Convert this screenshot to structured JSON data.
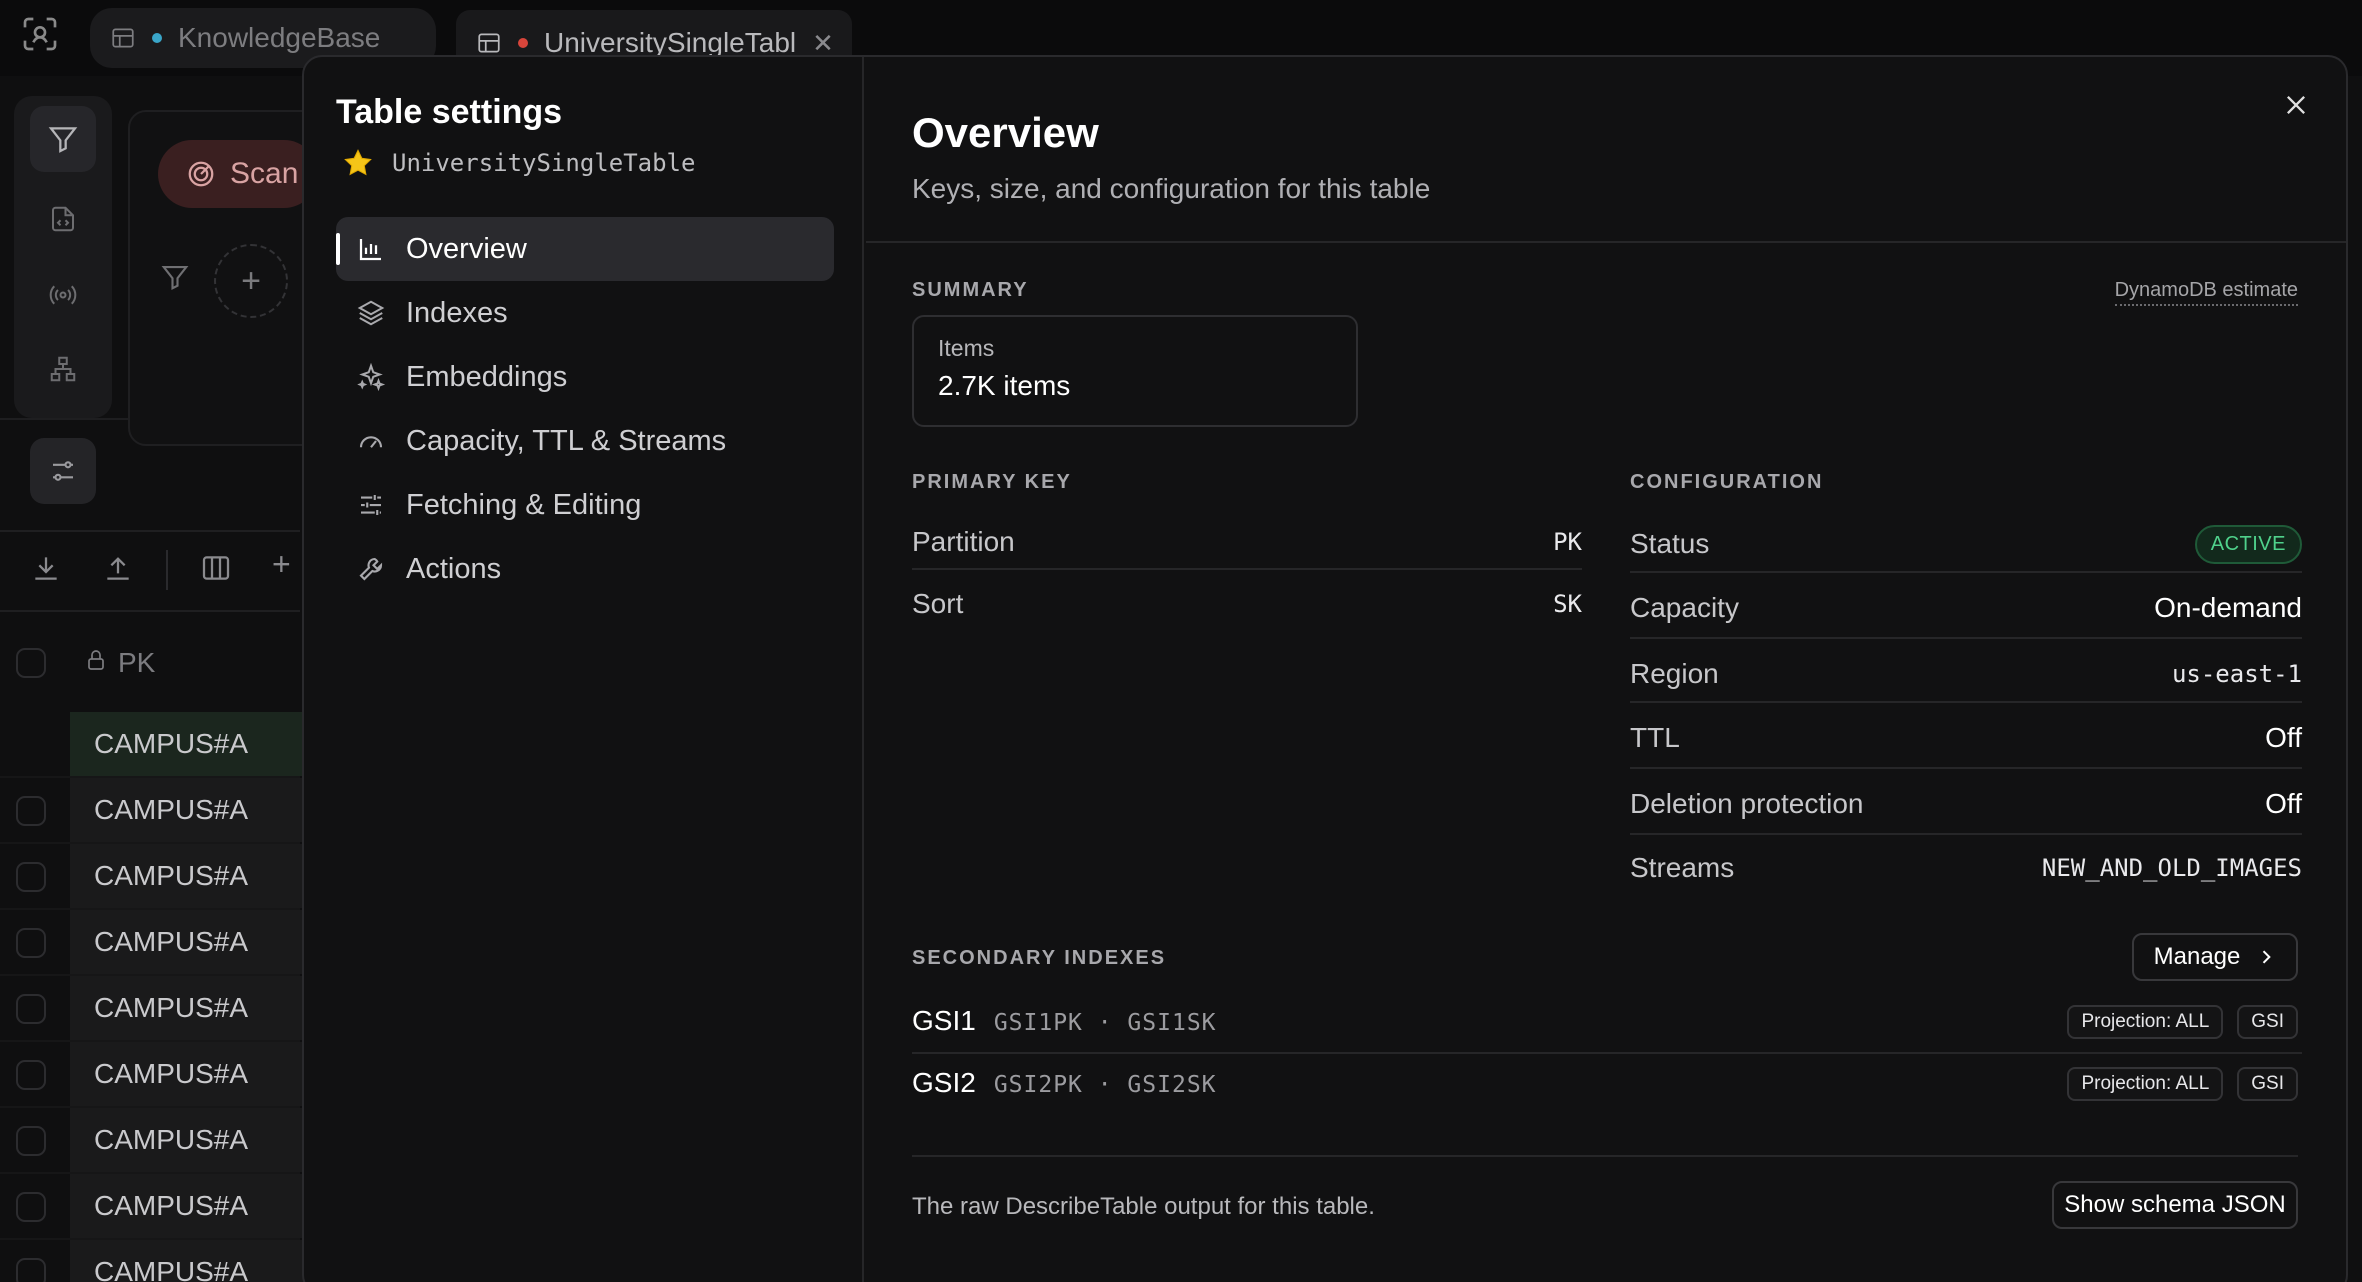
{
  "tabs": [
    {
      "label": "KnowledgeBase",
      "dot_color": "#3aa6c9"
    },
    {
      "label": "UniversitySingleTabl",
      "dot_color": "#d8453b"
    }
  ],
  "background": {
    "scan_label": "Scan",
    "pk_header": "PK",
    "rows": [
      "CAMPUS#A",
      "CAMPUS#A",
      "CAMPUS#A",
      "CAMPUS#A",
      "CAMPUS#A",
      "CAMPUS#A",
      "CAMPUS#A",
      "CAMPUS#A",
      "CAMPUS#A"
    ]
  },
  "sidebar": {
    "title": "Table settings",
    "table_name": "UniversitySingleTable",
    "items": [
      {
        "label": "Overview",
        "icon": "bar-chart-icon",
        "active": true
      },
      {
        "label": "Indexes",
        "icon": "layers-icon"
      },
      {
        "label": "Embeddings",
        "icon": "sparkles-icon"
      },
      {
        "label": "Capacity, TTL & Streams",
        "icon": "gauge-icon"
      },
      {
        "label": "Fetching & Editing",
        "icon": "sliders-icon"
      },
      {
        "label": "Actions",
        "icon": "wrench-icon"
      }
    ]
  },
  "overview": {
    "title": "Overview",
    "subtitle": "Keys, size, and configuration for this table",
    "summary_label": "SUMMARY",
    "estimate_label": "DynamoDB estimate",
    "items_label": "Items",
    "items_value": "2.7K items",
    "primary_key": {
      "label": "PRIMARY KEY",
      "partition_label": "Partition",
      "partition_value": "PK",
      "sort_label": "Sort",
      "sort_value": "SK"
    },
    "configuration": {
      "label": "CONFIGURATION",
      "status_label": "Status",
      "status_value": "ACTIVE",
      "capacity_label": "Capacity",
      "capacity_value": "On-demand",
      "region_label": "Region",
      "region_value": "us-east-1",
      "ttl_label": "TTL",
      "ttl_value": "Off",
      "deletion_label": "Deletion protection",
      "deletion_value": "Off",
      "streams_label": "Streams",
      "streams_value": "NEW_AND_OLD_IMAGES"
    },
    "secondary": {
      "label": "SECONDARY INDEXES",
      "manage_label": "Manage",
      "indexes": [
        {
          "name": "GSI1",
          "keys": "GSI1PK · GSI1SK",
          "projection": "Projection: ALL",
          "type": "GSI"
        },
        {
          "name": "GSI2",
          "keys": "GSI2PK · GSI2SK",
          "projection": "Projection: ALL",
          "type": "GSI"
        }
      ]
    },
    "footer_text": "The raw DescribeTable output for this table.",
    "schema_button": "Show schema JSON"
  },
  "colors": {
    "active_badge": "#4fd18b",
    "background": "#0f0f10",
    "modal": "#111112"
  }
}
